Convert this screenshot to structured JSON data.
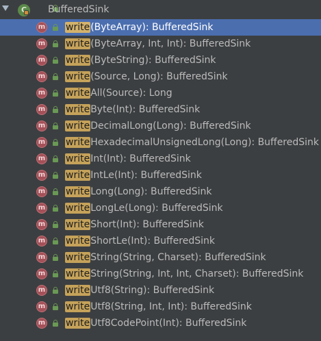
{
  "root": {
    "icon_letter": "C",
    "label": "BufferedSink"
  },
  "highlight": "write",
  "methods": [
    {
      "suffix": "(ByteArray): BufferedSink"
    },
    {
      "suffix": "(ByteArray, Int, Int): BufferedSink"
    },
    {
      "suffix": "(ByteString): BufferedSink"
    },
    {
      "suffix": "(Source, Long): BufferedSink"
    },
    {
      "suffix": "All(Source): Long"
    },
    {
      "suffix": "Byte(Int): BufferedSink"
    },
    {
      "suffix": "DecimalLong(Long): BufferedSink"
    },
    {
      "suffix": "HexadecimalUnsignedLong(Long): BufferedSink"
    },
    {
      "suffix": "Int(Int): BufferedSink"
    },
    {
      "suffix": "IntLe(Int): BufferedSink"
    },
    {
      "suffix": "Long(Long): BufferedSink"
    },
    {
      "suffix": "LongLe(Long): BufferedSink"
    },
    {
      "suffix": "Short(Int): BufferedSink"
    },
    {
      "suffix": "ShortLe(Int): BufferedSink"
    },
    {
      "suffix": "String(String, Charset): BufferedSink"
    },
    {
      "suffix": "String(String, Int, Int, Charset): BufferedSink"
    },
    {
      "suffix": "Utf8(String): BufferedSink"
    },
    {
      "suffix": "Utf8(String, Int, Int): BufferedSink"
    },
    {
      "suffix": "Utf8CodePoint(Int): BufferedSink"
    }
  ],
  "method_icon_letter": "m",
  "selected_index": 0,
  "colors": {
    "background": "#3c3f41",
    "selection": "#4b6eaf",
    "highlight": "#c5a25a",
    "method_icon": "#a45058",
    "lock": "#6a9955"
  }
}
